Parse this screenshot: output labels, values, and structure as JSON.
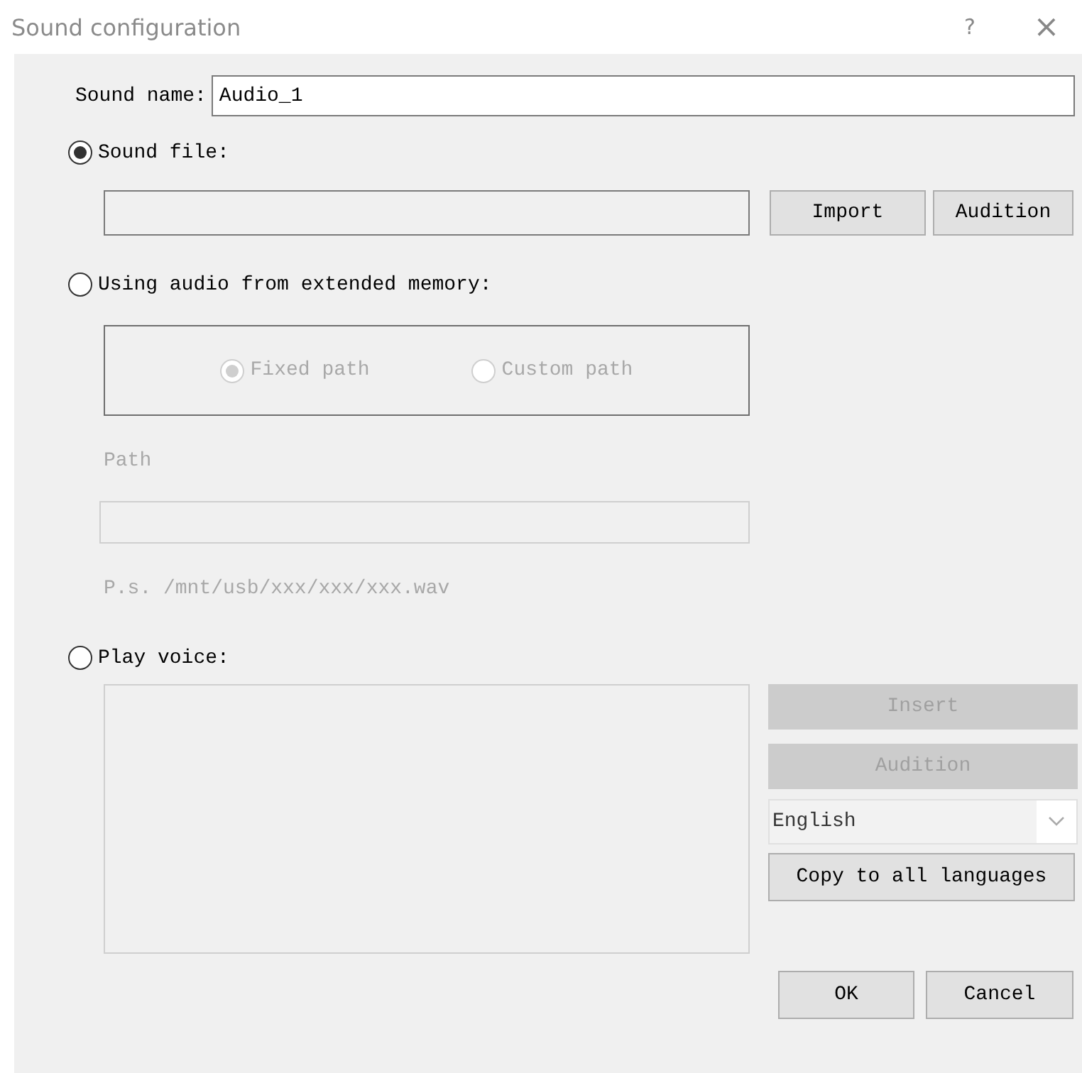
{
  "window": {
    "title": "Sound configuration",
    "help": "?",
    "close": "×"
  },
  "sound_name": {
    "label": "Sound name:",
    "value": "Audio_1"
  },
  "sound_file": {
    "label": "Sound file:",
    "selected": true,
    "buttons": [
      {
        "label": "Import",
        "disabled": false
      },
      {
        "label": "Audition",
        "disabled": false
      }
    ]
  },
  "extended_memory": {
    "label": "Using audio from extended memory:",
    "selected": false,
    "path_options": [
      {
        "label": "Fixed path",
        "selected": true,
        "disabled": true
      },
      {
        "label": "Custom path",
        "selected": false,
        "disabled": true
      }
    ],
    "path_label": "Path",
    "path_disabled": true,
    "hint": "P.s. /mnt/usb/xxx/xxx/xxx.wav"
  },
  "play_voice": {
    "label": "Play voice:",
    "selected": false,
    "buttons": [
      {
        "label": "Insert",
        "disabled": true
      },
      {
        "label": "Audition",
        "disabled": true
      }
    ],
    "language": "English",
    "copy_button": "Copy to all languages"
  },
  "footer_buttons": [
    "OK",
    "Cancel"
  ]
}
